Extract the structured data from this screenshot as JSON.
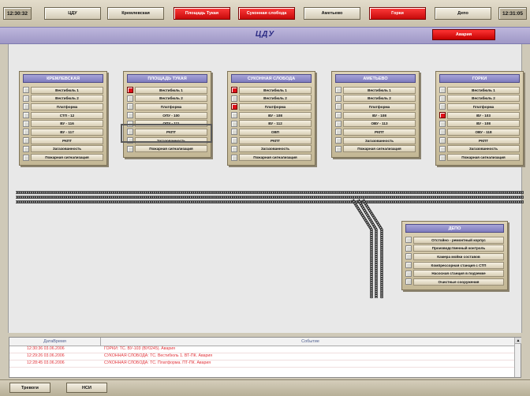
{
  "topbar": {
    "time_left": "12:30:32",
    "time_right": "12:31:05",
    "nav": [
      {
        "label": "ЦДУ",
        "alarm": false
      },
      {
        "label": "Кремлевская",
        "alarm": false
      },
      {
        "label": "Площадь Тукая",
        "alarm": true
      },
      {
        "label": "Суконная слобода",
        "alarm": true
      },
      {
        "label": "Аметьево",
        "alarm": false
      },
      {
        "label": "Горки",
        "alarm": true
      },
      {
        "label": "Депо",
        "alarm": false
      }
    ]
  },
  "title": "ЦДУ",
  "alarm_button": "Авария",
  "alarm_color": "#e0101a",
  "stations": [
    {
      "name": "КРЕМЛЕВСКАЯ",
      "rows": [
        {
          "label": "Вестибюль 1",
          "alarm": false
        },
        {
          "label": "Вестибюль 2",
          "alarm": false
        },
        {
          "label": "Платформа",
          "alarm": false
        },
        {
          "label": "СТП - 12",
          "alarm": false
        },
        {
          "label": "ВУ - 116",
          "alarm": false
        },
        {
          "label": "ВУ - 117",
          "alarm": false
        },
        {
          "label": "РКПТ",
          "alarm": false
        },
        {
          "label": "Загазованность",
          "alarm": false
        },
        {
          "label": "Пожарная сигнализация",
          "alarm": false
        }
      ]
    },
    {
      "name": "ПЛОЩАДЬ ТУКАЯ",
      "rows": [
        {
          "label": "Вестибюль 1",
          "alarm": true
        },
        {
          "label": "Вестибюль 2",
          "alarm": false
        },
        {
          "label": "Платформа",
          "alarm": false
        },
        {
          "label": "ОПУ - 100",
          "alarm": false
        },
        {
          "label": "ОПУ - 111",
          "alarm": false
        },
        {
          "label": "РКПТ",
          "alarm": false
        },
        {
          "label": "Загазованность",
          "alarm": false
        },
        {
          "label": "Пожарная сигнализация",
          "alarm": false
        }
      ]
    },
    {
      "name": "СУКОННАЯ СЛОБОДА",
      "rows": [
        {
          "label": "Вестибюль 1",
          "alarm": true
        },
        {
          "label": "Вестибюль 2",
          "alarm": false
        },
        {
          "label": "Платформа",
          "alarm": true
        },
        {
          "label": "ВУ - 108",
          "alarm": false
        },
        {
          "label": "ВУ - 112",
          "alarm": false
        },
        {
          "label": "ОВП",
          "alarm": false
        },
        {
          "label": "РКПТ",
          "alarm": false
        },
        {
          "label": "Загазованность",
          "alarm": false
        },
        {
          "label": "Пожарная сигнализация",
          "alarm": false
        }
      ]
    },
    {
      "name": "АМЕТЬЕВО",
      "rows": [
        {
          "label": "Вестибюль 1",
          "alarm": false
        },
        {
          "label": "Вестибюль 2",
          "alarm": false
        },
        {
          "label": "Платформа",
          "alarm": false
        },
        {
          "label": "ВУ - 108",
          "alarm": false
        },
        {
          "label": "ОВУ - 113",
          "alarm": false
        },
        {
          "label": "РКПТ",
          "alarm": false
        },
        {
          "label": "Загазованность",
          "alarm": false
        },
        {
          "label": "Пожарная сигнализация",
          "alarm": false
        }
      ]
    },
    {
      "name": "ГОРКИ",
      "rows": [
        {
          "label": "Вестибюль 1",
          "alarm": false
        },
        {
          "label": "Вестибюль 2",
          "alarm": false
        },
        {
          "label": "Платформа",
          "alarm": false
        },
        {
          "label": "ВУ - 103",
          "alarm": true
        },
        {
          "label": "ВУ - 108",
          "alarm": false
        },
        {
          "label": "ОВУ - 118",
          "alarm": false
        },
        {
          "label": "РКПТ",
          "alarm": false
        },
        {
          "label": "Загазованность",
          "alarm": false
        },
        {
          "label": "Пожарная сигнализация",
          "alarm": false
        }
      ]
    }
  ],
  "depot": {
    "name": "ДЕПО",
    "rows": [
      {
        "label": "Отстойно - ремонтный корпус",
        "alarm": false
      },
      {
        "label": "Производственный контроль",
        "alarm": false
      },
      {
        "label": "Камера мойки составов",
        "alarm": false
      },
      {
        "label": "Компрессорная станция с СТП",
        "alarm": false
      },
      {
        "label": "Насосная станция в подземке",
        "alarm": false
      },
      {
        "label": "Очистные сооружения",
        "alarm": false
      }
    ]
  },
  "log": {
    "columns": [
      "ДатаВремя",
      "Событие"
    ],
    "rows": [
      {
        "datetime": "12:30:36  03.06.2006",
        "event": "ГОРКИ: ТС. ВУ-103 (ВУ0245). Авария"
      },
      {
        "datetime": "12:29:26  03.06.2006",
        "event": "СУКОННАЯ СЛОБОДА: ТС. Вестибюль 1. ВТ-ПК. Авария"
      },
      {
        "datetime": "12:28:45  03.06.2006",
        "event": "СУКОННАЯ СЛОБОДА: ТС. Платформа. ПТ-ПК. Авария"
      }
    ]
  },
  "bottombar": {
    "btn1": "Тревоги",
    "btn2": "НСИ"
  }
}
